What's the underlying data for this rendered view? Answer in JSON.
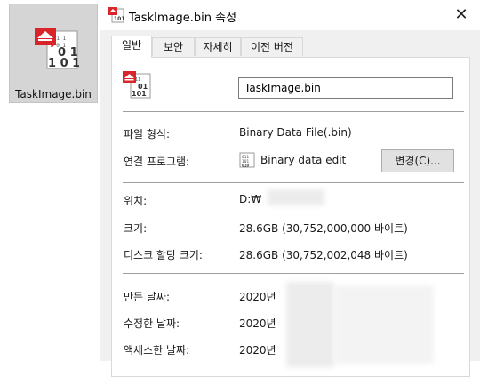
{
  "desktop": {
    "icon_label": "TaskImage.bin"
  },
  "dialog": {
    "title": "TaskImage.bin 속성",
    "tabs": [
      "일반",
      "보안",
      "자세히",
      "이전 버전"
    ],
    "file_name": "TaskImage.bin",
    "file_type_label": "파일 형식:",
    "file_type_value": "Binary Data File(.bin)",
    "opens_with_label": "연결 프로그램:",
    "opens_with_value": "Binary data edit",
    "change_button": "변경(C)...",
    "location_label": "위치:",
    "location_value": "D:₩",
    "size_label": "크기:",
    "size_value": "28.6GB (30,752,000,000 바이트)",
    "disk_size_label": "디스크 할당 크기:",
    "disk_size_value": "28.6GB (30,752,002,048 바이트)",
    "created_label": "만든 날짜:",
    "created_value": "2020년",
    "modified_label": "수정한 날짜:",
    "modified_value": "2020년",
    "accessed_label": "액세스한 날짜:",
    "accessed_value": "2020년"
  }
}
